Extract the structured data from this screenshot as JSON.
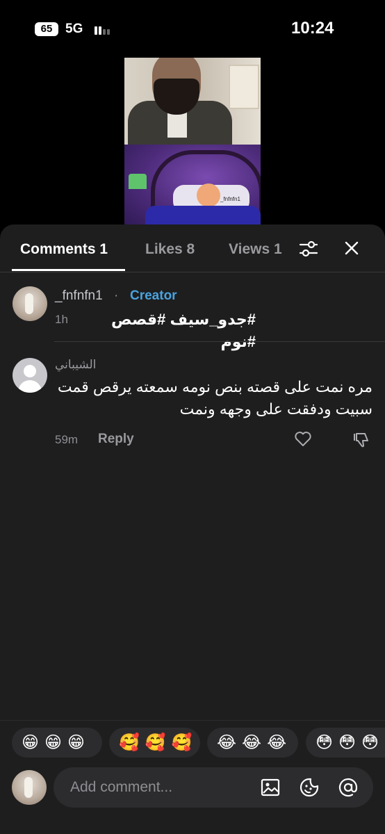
{
  "status_bar": {
    "battery": "65",
    "network": "5G",
    "time": "10:24"
  },
  "tabs": [
    {
      "label": "Comments 1",
      "active": true
    },
    {
      "label": "Likes 8",
      "active": false
    },
    {
      "label": "Views 1",
      "active": false
    }
  ],
  "comments": [
    {
      "username": "_fnfnfn1",
      "separator": "·",
      "badge": "Creator",
      "time": "1h",
      "text": "#جدو_سيف #قصص #نوم"
    },
    {
      "username": "الشيباني",
      "time": "59m",
      "text": "مره نمت على قصته بنص نومه سمعته يرقص قمت سبيت ودفقت على وجهه ونمت",
      "reply_label": "Reply"
    }
  ],
  "video": {
    "watermark": "_fnfnfn1"
  },
  "emoji_groups": [
    {
      "emojis": "😁😁😁"
    },
    {
      "emojis": "🥰🥰🥰"
    },
    {
      "emojis": "😂😂😂"
    },
    {
      "emojis": "😳😳😳"
    }
  ],
  "compose": {
    "placeholder": "Add comment..."
  },
  "colors": {
    "background": "#000000",
    "panel": "#1e1e1f",
    "creator_badge": "#4aa3df"
  }
}
